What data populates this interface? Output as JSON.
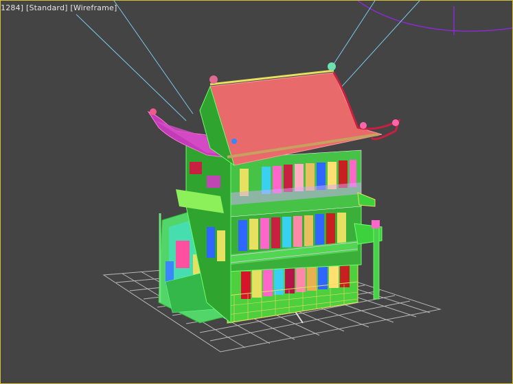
{
  "viewport": {
    "label_parts": [
      "1284]",
      "[Standard]",
      "[Wireframe]"
    ],
    "background": "#444444",
    "border_color": "#d6c23a"
  },
  "scene": {
    "object": "chinese-pavilion-wireframe",
    "colors": {
      "roof": "#e06a6a",
      "roof_side": "#c044b4",
      "frame_green": "#3ed13e",
      "grid": "#b0b0b0",
      "light_line": "#7cc8ee",
      "camera_arc": "#8a2bd0",
      "yellow": "#e8e060"
    }
  }
}
